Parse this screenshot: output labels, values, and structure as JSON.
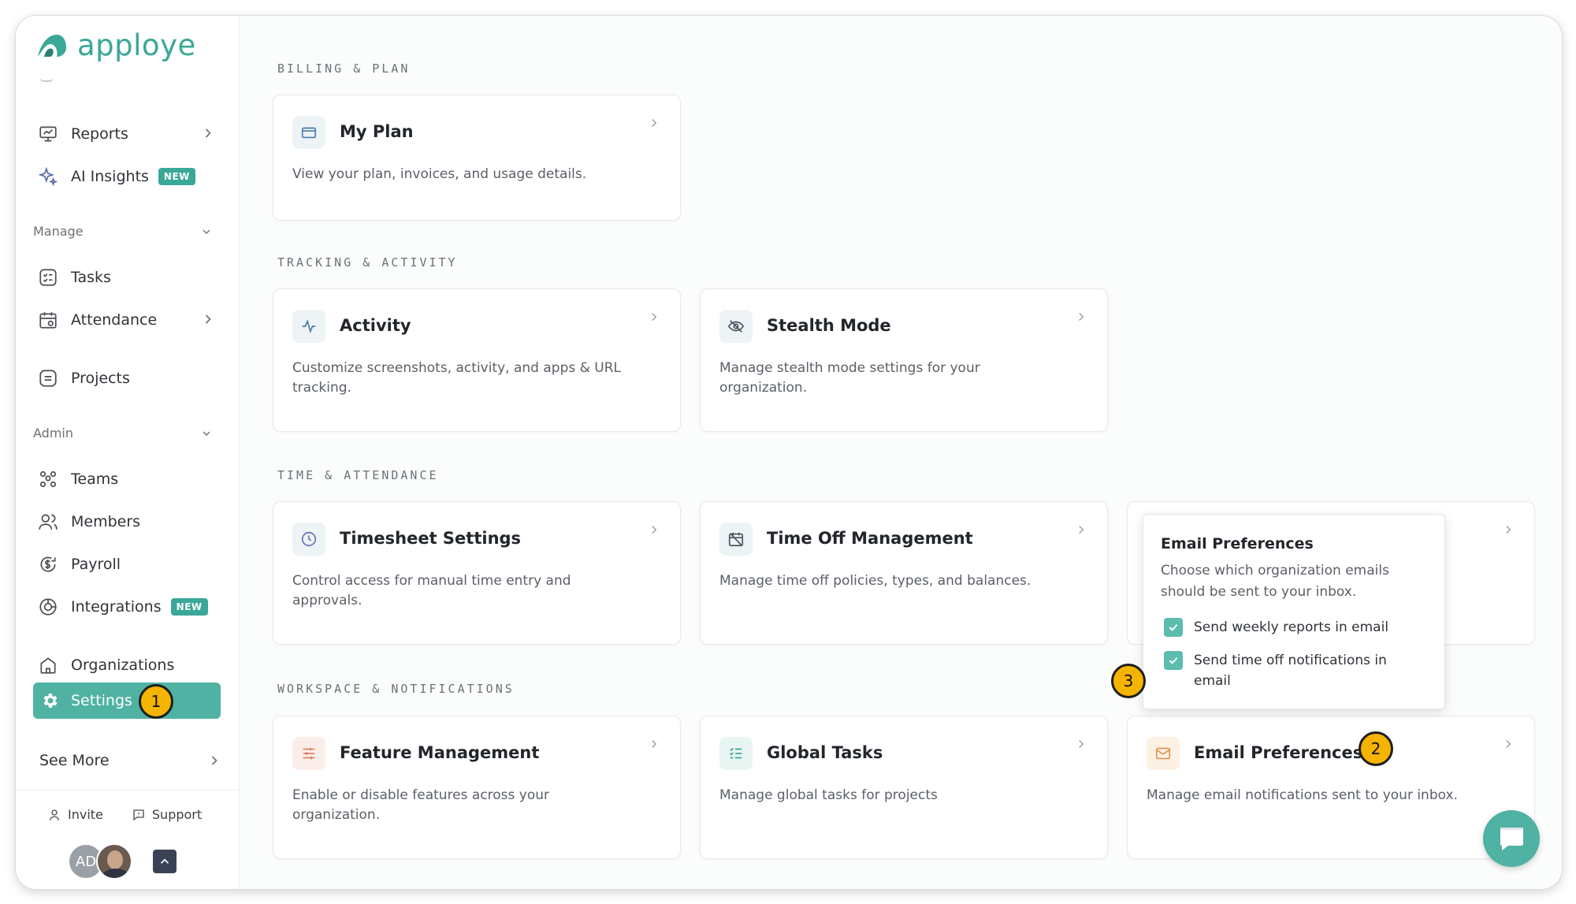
{
  "brand": {
    "name": "apploye",
    "color": "#3aa898"
  },
  "sidebar": {
    "items_top": [
      {
        "label": "Reports",
        "icon": "presentation-chart-icon",
        "has_chevron": true
      },
      {
        "label": "AI Insights",
        "icon": "sparkle-icon",
        "badge": "NEW"
      }
    ],
    "manage_label": "Manage",
    "manage_items": [
      {
        "label": "Tasks",
        "icon": "checklist-icon"
      },
      {
        "label": "Attendance",
        "icon": "calendar-icon",
        "has_chevron": true
      },
      {
        "label": "Projects",
        "icon": "document-icon"
      }
    ],
    "admin_label": "Admin",
    "admin_items": [
      {
        "label": "Teams",
        "icon": "teams-icon"
      },
      {
        "label": "Members",
        "icon": "members-icon"
      },
      {
        "label": "Payroll",
        "icon": "payroll-icon"
      },
      {
        "label": "Integrations",
        "icon": "integrations-icon",
        "badge": "NEW"
      },
      {
        "label": "Organizations",
        "icon": "home-icon"
      }
    ],
    "active_item": {
      "label": "Settings",
      "icon": "gear-icon",
      "marker": "1"
    },
    "see_more": "See More",
    "footer": {
      "invite": "Invite",
      "support": "Support"
    },
    "avatar_initials": "AD"
  },
  "groups": {
    "billing": "BILLING & PLAN",
    "tracking": "TRACKING & ACTIVITY",
    "time": "TIME & ATTENDANCE",
    "workspace": "WORKSPACE & NOTIFICATIONS"
  },
  "cards": {
    "my_plan": {
      "title": "My Plan",
      "desc": "View your plan, invoices, and usage details.",
      "icon": "credit-card-icon"
    },
    "activity": {
      "title": "Activity",
      "desc": "Customize screenshots, activity, and apps & URL tracking.",
      "icon": "activity-pulse-icon"
    },
    "stealth": {
      "title": "Stealth Mode",
      "desc": "Manage stealth mode settings for your organization.",
      "icon": "eye-off-icon"
    },
    "timesheet": {
      "title": "Timesheet Settings",
      "desc": "Control access for manual time entry and approvals.",
      "icon": "clock-icon"
    },
    "time_off": {
      "title": "Time Off Management",
      "desc": "Manage time off policies, types, and balances.",
      "icon": "calendar-off-icon"
    },
    "feature": {
      "title": "Feature Management",
      "desc": "Enable or disable features across your organization.",
      "icon": "sliders-icon"
    },
    "global_tasks": {
      "title": "Global Tasks",
      "desc": "Manage global tasks for projects",
      "icon": "task-list-icon"
    },
    "email_prefs": {
      "title": "Email Preferences",
      "desc": "Manage email notifications sent to your inbox.",
      "icon": "mail-icon",
      "marker": "2"
    }
  },
  "popover": {
    "title": "Email Preferences",
    "desc": "Choose which organization emails should be sent to your inbox.",
    "options": [
      {
        "label": "Send weekly reports in email",
        "checked": true
      },
      {
        "label": "Send time off notifications in email",
        "checked": true
      }
    ],
    "marker": "3"
  },
  "colors": {
    "accent": "#4fb2a3",
    "marker": "#f5b400",
    "checkbox": "#5cbcad"
  }
}
